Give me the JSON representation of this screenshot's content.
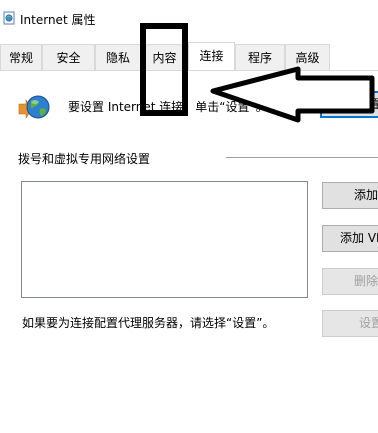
{
  "window": {
    "title": "Internet 属性"
  },
  "tabs": [
    {
      "label": "常规"
    },
    {
      "label": "安全"
    },
    {
      "label": "隐私"
    },
    {
      "label": "内容"
    },
    {
      "label": "连接",
      "active": true
    },
    {
      "label": "程序"
    },
    {
      "label": "高级"
    }
  ],
  "setup": {
    "text": "要设置 Internet 连接，单击“设置”。",
    "button_label": "设置"
  },
  "dialup": {
    "section_label": "拨号和虚拟专用网络设置",
    "add_label": "添加",
    "add_vpn_label": "添加 VPN",
    "remove_label": "删除",
    "settings_label": "设置"
  },
  "hint": "如果要为连接配置代理服务器，请选择“设置”。",
  "icons": {
    "title": "internet-options-icon",
    "setup": "globe-network-icon",
    "annotation_box": "highlight-rectangle",
    "annotation_arrow": "pointing-arrow"
  }
}
